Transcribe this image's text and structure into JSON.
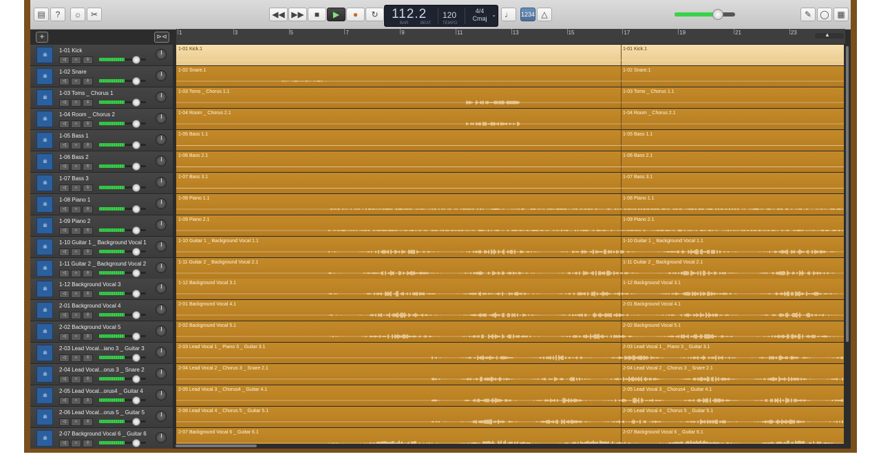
{
  "transport": {
    "bar_beat": "112.2",
    "bar_label": "BAR",
    "beat_label": "BEAT",
    "tempo": "120",
    "tempo_label": "TEMPO",
    "time_signature": "4/4",
    "key": "Cmaj",
    "count_in": "1234"
  },
  "ruler": {
    "bars": [
      "1",
      "3",
      "5",
      "7",
      "9",
      "11",
      "13",
      "15",
      "17",
      "19",
      "21",
      "23"
    ]
  },
  "master_volume_level": 0.72,
  "tracks": [
    {
      "name": "1-01 Kick",
      "volume": 0.78,
      "region": "1-01 Kick.1",
      "region2": "1-01 Kick.1",
      "wave": "none"
    },
    {
      "name": "1-02 Snare",
      "volume": 0.78,
      "region": "1-02 Snare.1",
      "region2": "1-02 Snare.1",
      "wave": "tiny"
    },
    {
      "name": "1-03 Toms _ Chorus 1",
      "volume": 0.78,
      "region": "1-03 Toms _ Chorus 1.1",
      "region2": "1-03 Toms _ Chorus 1.1",
      "wave": "toms"
    },
    {
      "name": "1-04 Room _ Chorus 2",
      "volume": 0.78,
      "region": "1-04 Room _ Chorus 2.1",
      "region2": "1-04 Room _ Chorus 2.1",
      "wave": "toms"
    },
    {
      "name": "1-05 Bass 1",
      "volume": 0.78,
      "region": "1-05 Bass 1.1",
      "region2": "1-05 Bass 1.1",
      "wave": "none"
    },
    {
      "name": "1-06 Bass 2",
      "volume": 0.78,
      "region": "1-06 Bass 2.1",
      "region2": "1-06 Bass 2.1",
      "wave": "none"
    },
    {
      "name": "1-07 Bass 3",
      "volume": 0.78,
      "region": "1-07 Bass 3.1",
      "region2": "1-07 Bass 3.1",
      "wave": "none"
    },
    {
      "name": "1-08 Piano 1",
      "volume": 0.78,
      "region": "1-08 Piano 1.1",
      "region2": "1-08 Piano 1.1",
      "wave": "thin"
    },
    {
      "name": "1-09 Piano 2",
      "volume": 0.78,
      "region": "1-09 Piano 2.1",
      "region2": "1-09 Piano 2.1",
      "wave": "thin"
    },
    {
      "name": "1-10 Guitar 1 _ Background Vocal 1",
      "volume": 0.78,
      "region": "1-10 Guitar 1 _ Background Vocal 1.1",
      "region2": "1-10 Guitar 1 _ Background Vocal 1.1",
      "wave": "full"
    },
    {
      "name": "1-11 Guitar 2 _ Background Vocal 2",
      "volume": 0.78,
      "region": "1-11 Guitar 2 _ Background Vocal 2.1",
      "region2": "1-11 Guitar 2 _ Background Vocal 2.1",
      "wave": "full"
    },
    {
      "name": "1-12 Background Vocal 3",
      "volume": 0.78,
      "region": "1-12 Background Vocal 3.1",
      "region2": "1-12 Background Vocal 3.1",
      "wave": "full"
    },
    {
      "name": "2-01 Background Vocal 4",
      "volume": 0.78,
      "region": "2-01 Background Vocal 4.1",
      "region2": "2-01 Background Vocal 4.1",
      "wave": "full"
    },
    {
      "name": "2-02 Background Vocal 5",
      "volume": 0.78,
      "region": "2-02 Background Vocal 5.1",
      "region2": "2-02 Background Vocal 5.1",
      "wave": "full"
    },
    {
      "name": "2-03 Lead Vocal...iano 3 _ Guitar 3",
      "volume": 0.78,
      "region": "2-03 Lead Vocal 1 _ Piano 3 _ Guitar 3.1",
      "region2": "2-03 Lead Vocal 1 _ Piano 3 _ Guitar 3.1",
      "wave": "vocal"
    },
    {
      "name": "2-04 Lead Vocal...orus 3 _ Snare 2",
      "volume": 0.78,
      "region": "2-04 Lead Vocal 2 _ Chorus 3 _ Snare 2.1",
      "region2": "2-04 Lead Vocal 2 _ Chorus 3 _ Snare 2.1",
      "wave": "vocal"
    },
    {
      "name": "2-05 Lead Vocal...orus4 _ Guitar 4",
      "volume": 0.78,
      "region": "2-05 Lead Vocal 3 _ Chorus4 _ Guitar 4.1",
      "region2": "2-05 Lead Vocal 3 _ Chorus4 _ Guitar 4.1",
      "wave": "vocal"
    },
    {
      "name": "2-06 Lead Vocal...orus 5 _ Guitar 5",
      "volume": 0.78,
      "region": "2-06 Lead Vocal 4 _ Chorus 5 _ Guitar 5.1",
      "region2": "2-06 Lead Vocal 4 _ Chorus 5 _ Guitar 5.1",
      "wave": "vocal"
    },
    {
      "name": "2-07 Background Vocal 6 _ Guitar 6",
      "volume": 0.78,
      "region": "2-07 Background Vocal 6 _ Guitar 6.1",
      "region2": "2-07 Background Vocal 6 _ Guitar 6.1",
      "wave": "full"
    }
  ],
  "colors": {
    "region": "#c48a29",
    "region_selected": "#f6dfae",
    "meter": "#39d24a",
    "track_icon": "#2b5f9e"
  },
  "icons": {
    "toolbar_left": [
      "library-icon",
      "help-icon",
      "smart-controls-icon",
      "scissors-icon"
    ],
    "transport": [
      "rewind-icon",
      "fast-forward-icon",
      "stop-icon",
      "play-icon",
      "record-icon",
      "cycle-icon"
    ],
    "right": [
      "tuner-icon",
      "metronome-icon",
      "notepad-icon",
      "loop-browser-icon",
      "media-browser-icon"
    ]
  }
}
